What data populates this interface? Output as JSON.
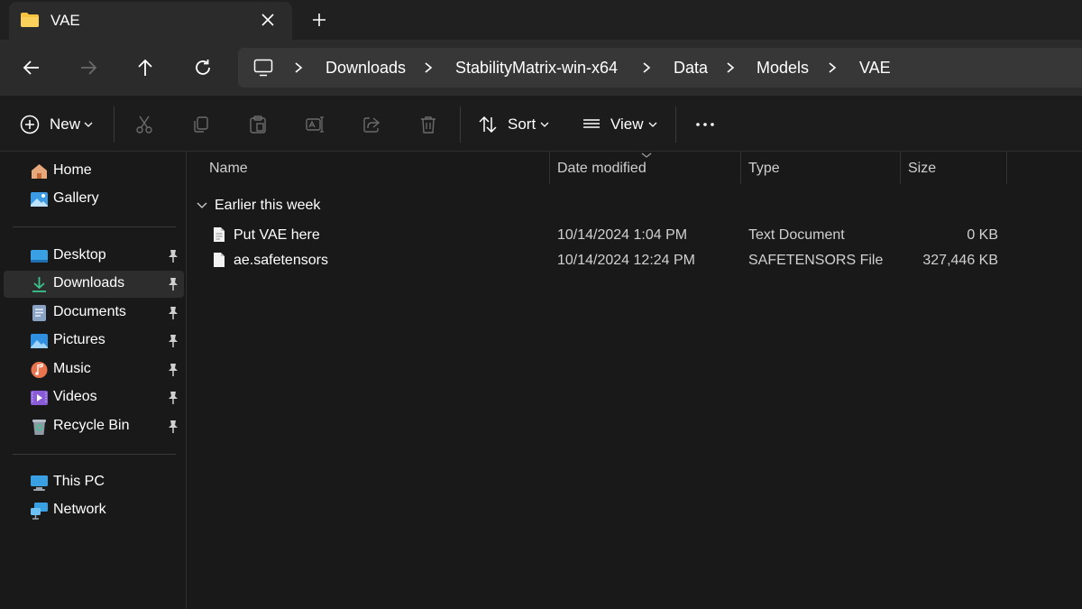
{
  "tab": {
    "title": "VAE"
  },
  "breadcrumbs": [
    "Downloads",
    "StabilityMatrix-win-x64",
    "Data",
    "Models",
    "VAE"
  ],
  "commandbar": {
    "new_label": "New",
    "sort_label": "Sort",
    "view_label": "View"
  },
  "sidebar": {
    "top": [
      {
        "label": "Home",
        "icon": "home-icon"
      },
      {
        "label": "Gallery",
        "icon": "gallery-icon"
      }
    ],
    "pinned": [
      {
        "label": "Desktop",
        "icon": "desktop-icon"
      },
      {
        "label": "Downloads",
        "icon": "downloads-icon",
        "selected": true
      },
      {
        "label": "Documents",
        "icon": "documents-icon"
      },
      {
        "label": "Pictures",
        "icon": "pictures-icon"
      },
      {
        "label": "Music",
        "icon": "music-icon"
      },
      {
        "label": "Videos",
        "icon": "videos-icon"
      },
      {
        "label": "Recycle Bin",
        "icon": "recycle-bin-icon"
      }
    ],
    "bottom": [
      {
        "label": "This PC",
        "icon": "this-pc-icon"
      },
      {
        "label": "Network",
        "icon": "network-icon"
      }
    ]
  },
  "columns": {
    "name": "Name",
    "date": "Date modified",
    "type": "Type",
    "size": "Size"
  },
  "group": {
    "label": "Earlier this week"
  },
  "files": [
    {
      "name": "Put VAE here",
      "date": "10/14/2024 1:04 PM",
      "type": "Text Document",
      "size": "0 KB",
      "icon": "text-file-icon"
    },
    {
      "name": "ae.safetensors",
      "date": "10/14/2024 12:24 PM",
      "type": "SAFETENSORS File",
      "size": "327,446 KB",
      "icon": "file-icon"
    }
  ],
  "colors": {
    "background": "#191919",
    "tabstrip": "#202020",
    "navbar": "#2b2b2b",
    "address": "#373737",
    "accent": "#4cc2ff",
    "folder": "#f8c440"
  }
}
